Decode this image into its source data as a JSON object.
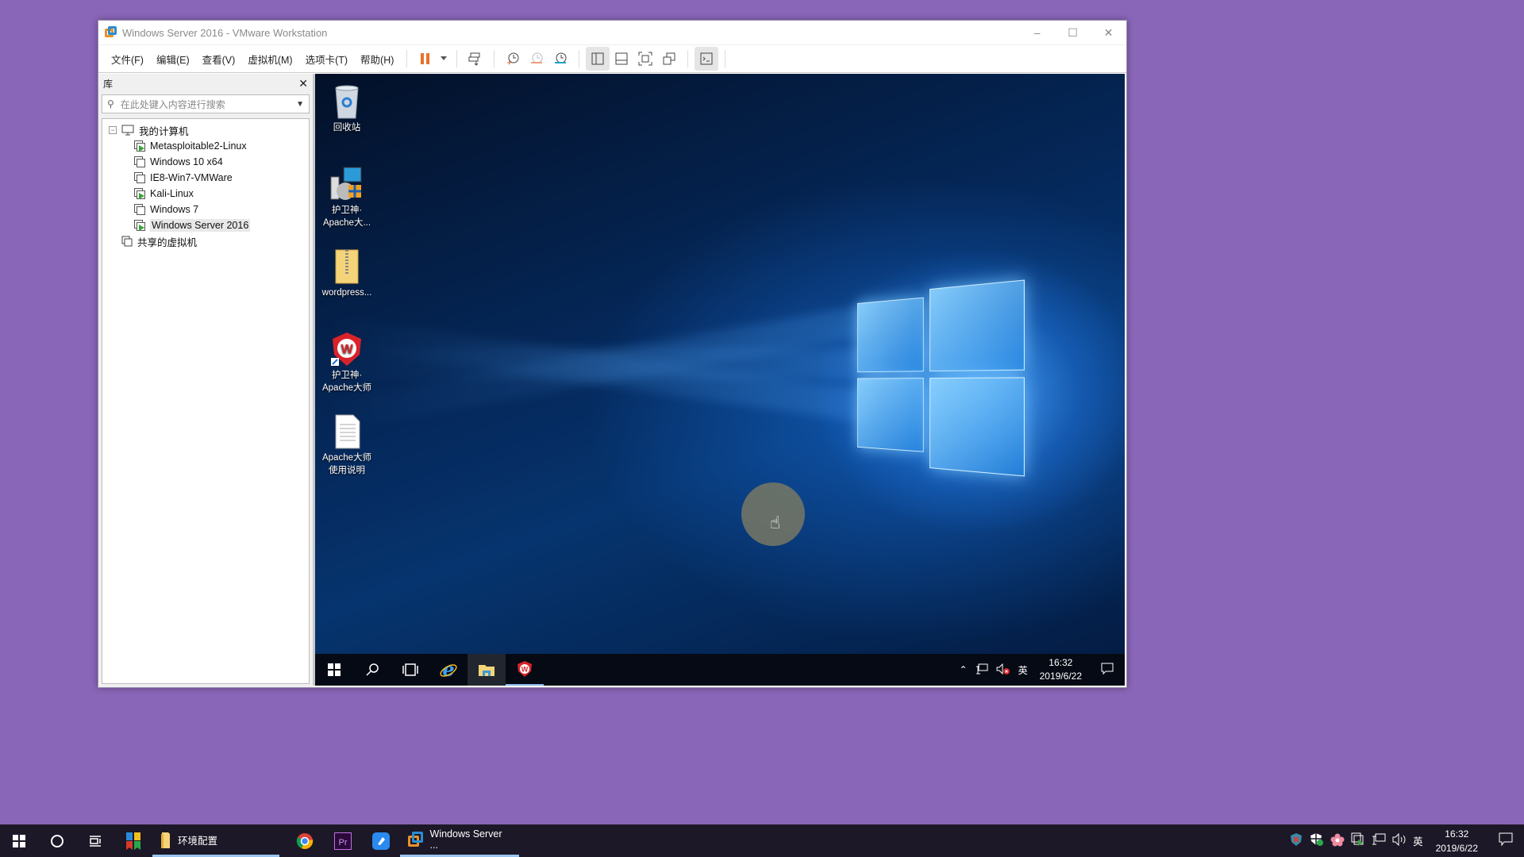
{
  "window": {
    "title": "Windows Server 2016 - VMware Workstation",
    "controls": {
      "minimize": "–",
      "maximize": "☐",
      "close": "✕"
    }
  },
  "menu": [
    "文件(F)",
    "编辑(E)",
    "查看(V)",
    "虚拟机(M)",
    "选项卡(T)",
    "帮助(H)"
  ],
  "toolbar": {
    "icons": [
      "pause-icon",
      "dropdown-icon",
      "send-ctrl-alt-del-icon",
      "snapshot-take-icon",
      "snapshot-revert-icon",
      "snapshot-manager-icon",
      "view-library-icon",
      "view-thumbnail-icon",
      "fullscreen-icon",
      "unity-icon",
      "console-icon"
    ],
    "accent": "#e8722a"
  },
  "library": {
    "title": "库",
    "close": "✕",
    "search_placeholder": "在此处键入内容进行搜索",
    "root": "我的计算机",
    "vms": [
      {
        "name": "Metasploitable2-Linux",
        "running": true
      },
      {
        "name": "Windows 10 x64",
        "running": false
      },
      {
        "name": "IE8-Win7-VMWare",
        "running": false
      },
      {
        "name": "Kali-Linux",
        "running": true
      },
      {
        "name": "Windows 7",
        "running": false
      },
      {
        "name": "Windows Server 2016",
        "running": true,
        "selected": true
      }
    ],
    "shared": "共享的虚拟机"
  },
  "guest": {
    "desktop_icons": [
      {
        "line1": "回收站",
        "line2": "",
        "icon": "recycle-bin-icon"
      },
      {
        "line1": "护卫神·",
        "line2": "Apache大...",
        "icon": "installer-icon"
      },
      {
        "line1": "wordpress...",
        "line2": "",
        "icon": "zip-folder-icon"
      },
      {
        "line1": "护卫神·",
        "line2": "Apache大师",
        "icon": "huweishen-shortcut-icon"
      },
      {
        "line1": "Apache大师",
        "line2": "使用说明",
        "icon": "text-document-icon"
      }
    ],
    "taskbar": {
      "tray_lang": "英",
      "time": "16:32",
      "date": "2019/6/22"
    }
  },
  "host_taskbar": {
    "apps": [
      {
        "label": "环境配置",
        "icon": "folder-icon",
        "open": true
      },
      {
        "label": "Windows Server ...",
        "icon": "vmware-icon",
        "open": true
      }
    ],
    "tray_lang": "英",
    "time": "16:32",
    "date": "2019/6/22"
  }
}
